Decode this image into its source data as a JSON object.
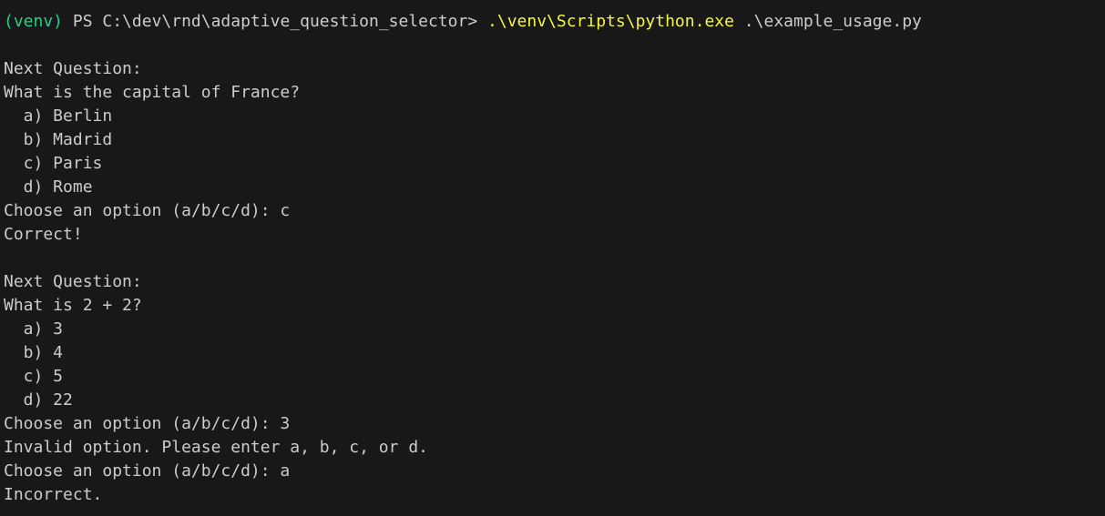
{
  "colors": {
    "background": "#181818",
    "text": "#cccccc",
    "venv": "#23d18b",
    "command": "#f5f543"
  },
  "prompt": {
    "venv": "(venv)",
    "path": " PS C:\\dev\\rnd\\adaptive_question_selector> ",
    "command": ".\\venv\\Scripts\\python.exe",
    "args": " .\\example_usage.py"
  },
  "output": [
    "",
    "Next Question:",
    "What is the capital of France?",
    "  a) Berlin",
    "  b) Madrid",
    "  c) Paris",
    "  d) Rome",
    "Choose an option (a/b/c/d): c",
    "Correct!",
    "",
    "Next Question:",
    "What is 2 + 2?",
    "  a) 3",
    "  b) 4",
    "  c) 5",
    "  d) 22",
    "Choose an option (a/b/c/d): 3",
    "Invalid option. Please enter a, b, c, or d.",
    "Choose an option (a/b/c/d): a",
    "Incorrect."
  ]
}
